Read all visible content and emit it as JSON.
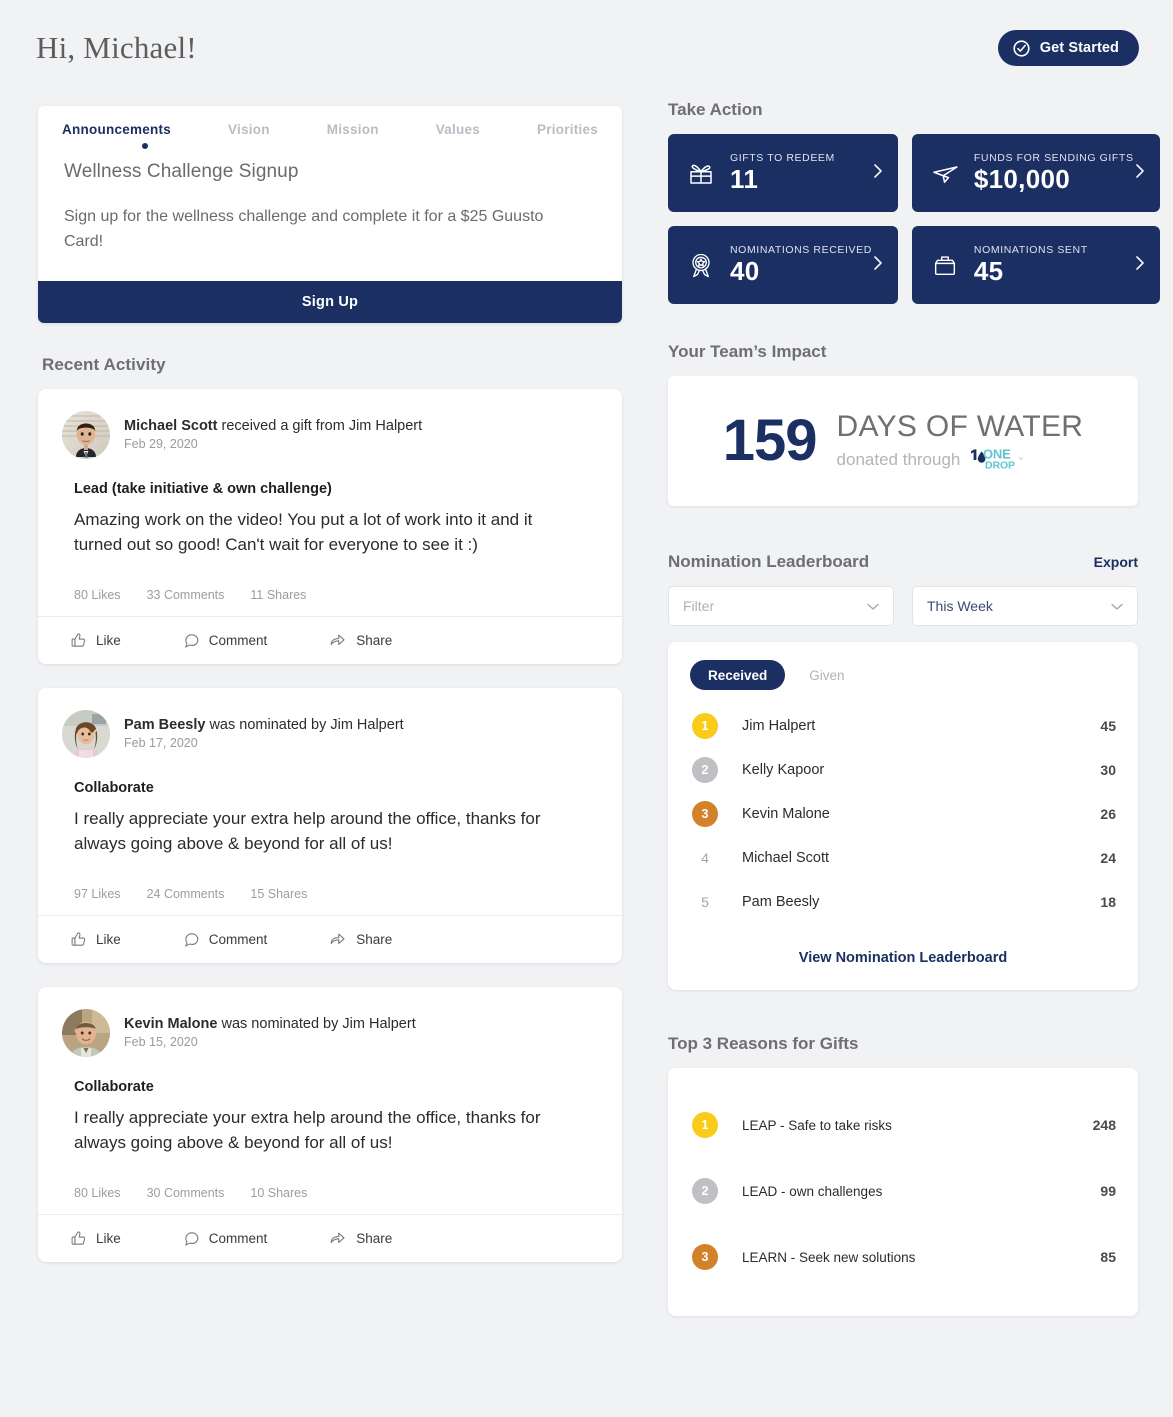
{
  "header": {
    "greeting": "Hi, Michael!",
    "get_started_label": "Get Started"
  },
  "announcements": {
    "tabs": [
      {
        "label": "Announcements",
        "active": true
      },
      {
        "label": "Vision",
        "active": false
      },
      {
        "label": "Mission",
        "active": false
      },
      {
        "label": "Values",
        "active": false
      },
      {
        "label": "Priorities",
        "active": false
      }
    ],
    "title": "Wellness Challenge Signup",
    "body": "Sign up for the wellness challenge and complete it for a $25 Guusto Card!",
    "cta_label": "Sign Up"
  },
  "recent_activity": {
    "section_title": "Recent Activity",
    "posts": [
      {
        "actor": "Michael Scott",
        "action": " received a gift from Jim Halpert",
        "date": "Feb 29, 2020",
        "value": "Lead (take initiative & own challenge)",
        "message": "Amazing work on the video! You put a lot of work into it and it turned out so good! Can't wait for everyone to see it :)",
        "likes": "80 Likes",
        "comments": "33 Comments",
        "shares": "11 Shares",
        "like_label": "Like",
        "comment_label": "Comment",
        "share_label": "Share",
        "avatar": "michael-scott-avatar"
      },
      {
        "actor": "Pam Beesly",
        "action": " was nominated by Jim Halpert",
        "date": "Feb 17, 2020",
        "value": "Collaborate",
        "message": "I really appreciate your extra help around the office, thanks for always going above & beyond for all of us!",
        "likes": "97 Likes",
        "comments": "24 Comments",
        "shares": "15 Shares",
        "like_label": "Like",
        "comment_label": "Comment",
        "share_label": "Share",
        "avatar": "pam-beesly-avatar"
      },
      {
        "actor": "Kevin Malone",
        "action": " was nominated by Jim Halpert",
        "date": "Feb 15, 2020",
        "value": "Collaborate",
        "message": "I really appreciate your extra help around the office, thanks for always going above & beyond for all of us!",
        "likes": "80 Likes",
        "comments": "30 Comments",
        "shares": "10 Shares",
        "like_label": "Like",
        "comment_label": "Comment",
        "share_label": "Share",
        "avatar": "kevin-malone-avatar"
      }
    ]
  },
  "take_action": {
    "section_title": "Take Action",
    "cards": [
      {
        "label": "GIFTS TO REDEEM",
        "value": "11",
        "icon": "gift-icon"
      },
      {
        "label": "FUNDS FOR SENDING GIFTS",
        "value": "$10,000",
        "icon": "paper-plane-icon"
      },
      {
        "label": "NOMINATIONS RECEIVED",
        "value": "40",
        "icon": "award-ribbon-icon"
      },
      {
        "label": "NOMINATIONS SENT",
        "value": "45",
        "icon": "outbox-tray-icon"
      }
    ]
  },
  "team_impact": {
    "section_title": "Your Team’s Impact",
    "number": "159",
    "headline": "DAYS OF WATER",
    "subline": "donated through",
    "partner": "ONE DROP"
  },
  "leaderboard": {
    "section_title": "Nomination Leaderboard",
    "export_label": "Export",
    "filter_placeholder": "Filter",
    "period_value": "This Week",
    "tabs": [
      {
        "label": "Received",
        "active": true
      },
      {
        "label": "Given",
        "active": false
      }
    ],
    "rows": [
      {
        "rank": "1",
        "name": "Jim Halpert",
        "score": "45",
        "badge": "#facb18"
      },
      {
        "rank": "2",
        "name": "Kelly Kapoor",
        "score": "30",
        "badge": "#bfc0c4"
      },
      {
        "rank": "3",
        "name": "Kevin Malone",
        "score": "26",
        "badge": "#d2832a"
      },
      {
        "rank": "4",
        "name": "Michael Scott",
        "score": "24",
        "badge": ""
      },
      {
        "rank": "5",
        "name": "Pam Beesly",
        "score": "18",
        "badge": ""
      }
    ],
    "view_all_label": "View Nomination Leaderboard"
  },
  "top_reasons": {
    "section_title": "Top 3 Reasons for Gifts",
    "rows": [
      {
        "rank": "1",
        "name": "LEAP - Safe to take risks",
        "score": "248",
        "badge": "#facb18"
      },
      {
        "rank": "2",
        "name": "LEAD - own challenges",
        "score": "99",
        "badge": "#bfc0c4"
      },
      {
        "rank": "3",
        "name": "LEARN - Seek new solutions",
        "score": "85",
        "badge": "#d2832a"
      }
    ]
  },
  "colors": {
    "navy": "#1b2f62",
    "page_bg": "#f1f2f4",
    "gold": "#facb18",
    "silver": "#bfc0c4",
    "bronze": "#d2832a",
    "teal": "#5fc6cf"
  }
}
